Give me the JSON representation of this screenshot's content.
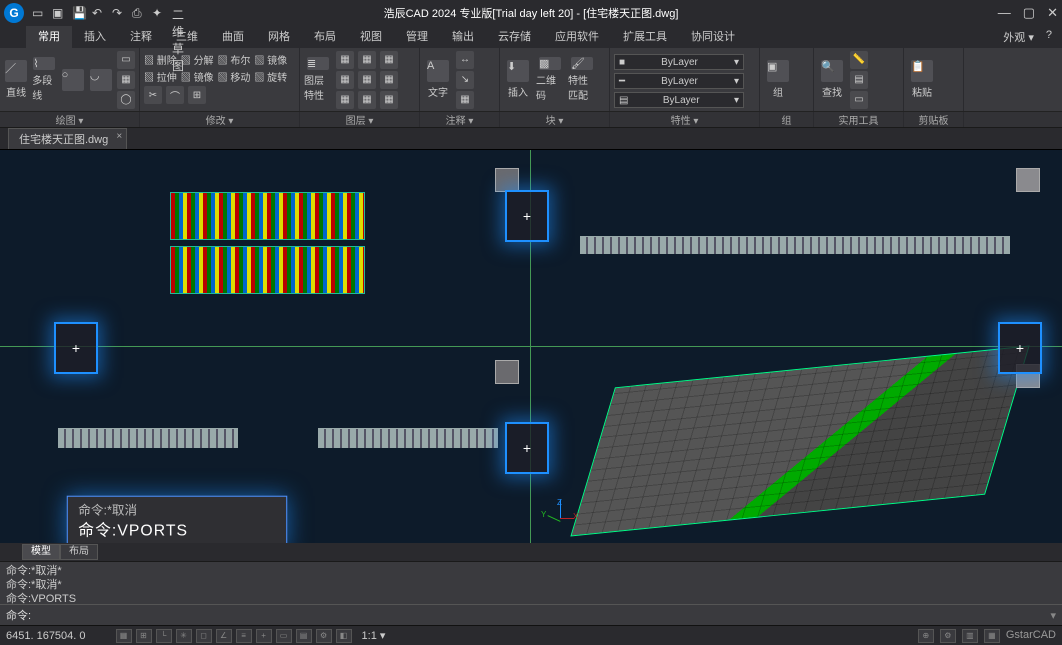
{
  "titlebar": {
    "app_title": "浩辰CAD 2024 专业版[Trial day left 20] - [住宅楼天正图.dwg]",
    "qat_dropdown": "二维草图"
  },
  "tabs": [
    "常用",
    "插入",
    "注释",
    "三维",
    "曲面",
    "网格",
    "布局",
    "视图",
    "管理",
    "输出",
    "云存储",
    "应用软件",
    "扩展工具",
    "协同设计"
  ],
  "right_menu": {
    "appearance": "外观",
    "help": "?"
  },
  "ribbon": {
    "draw": {
      "line": "直线",
      "polyline": "多段线",
      "circle_glyph": "○",
      "arc_glyph": "◡",
      "label": "绘图 ▾"
    },
    "modify": {
      "items": [
        "删除",
        "分解",
        "布尔",
        "镜像",
        "拉伸",
        "镜像",
        "移动",
        "旋转"
      ],
      "prefix": "▧",
      "label": "修改 ▾"
    },
    "layer": {
      "big": "图层特性",
      "label": "图层 ▾"
    },
    "annotate": {
      "text": "文字",
      "a_glyph": "A",
      "label": "注释 ▾"
    },
    "block": {
      "insert": "插入",
      "qr": "二维码",
      "match": "特性匹配",
      "label": "块 ▾"
    },
    "properties": {
      "bylayer": "ByLayer",
      "label": "特性 ▾"
    },
    "group": {
      "group": "组",
      "label": "组"
    },
    "utils": {
      "find": "查找",
      "label": "实用工具"
    },
    "clipboard": {
      "paste": "粘贴",
      "label": "剪贴板"
    }
  },
  "panel_widths": {
    "draw": 140,
    "modify": 160,
    "layer": 120,
    "annotate": 80,
    "block": 110,
    "properties": 150,
    "group": 54,
    "utils": 90,
    "clipboard": 60
  },
  "doc_tab": {
    "name": "住宅楼天正图.dwg",
    "close": "×"
  },
  "viewports": {
    "cmd_hint_top": "命令:*取消",
    "cmd_main": "命令:VPORTS",
    "axis": {
      "x": "X",
      "y": "Y",
      "z": "Z"
    }
  },
  "model_tabs": {
    "model": "模型",
    "layout": "布局"
  },
  "command_history": [
    "命令:*取消*",
    "命令:*取消*",
    "命令:VPORTS"
  ],
  "command_prompt": "命令:",
  "status": {
    "coords": "6451. 167504. 0",
    "scale": "1:1 ▾",
    "brand": "GstarCAD"
  }
}
